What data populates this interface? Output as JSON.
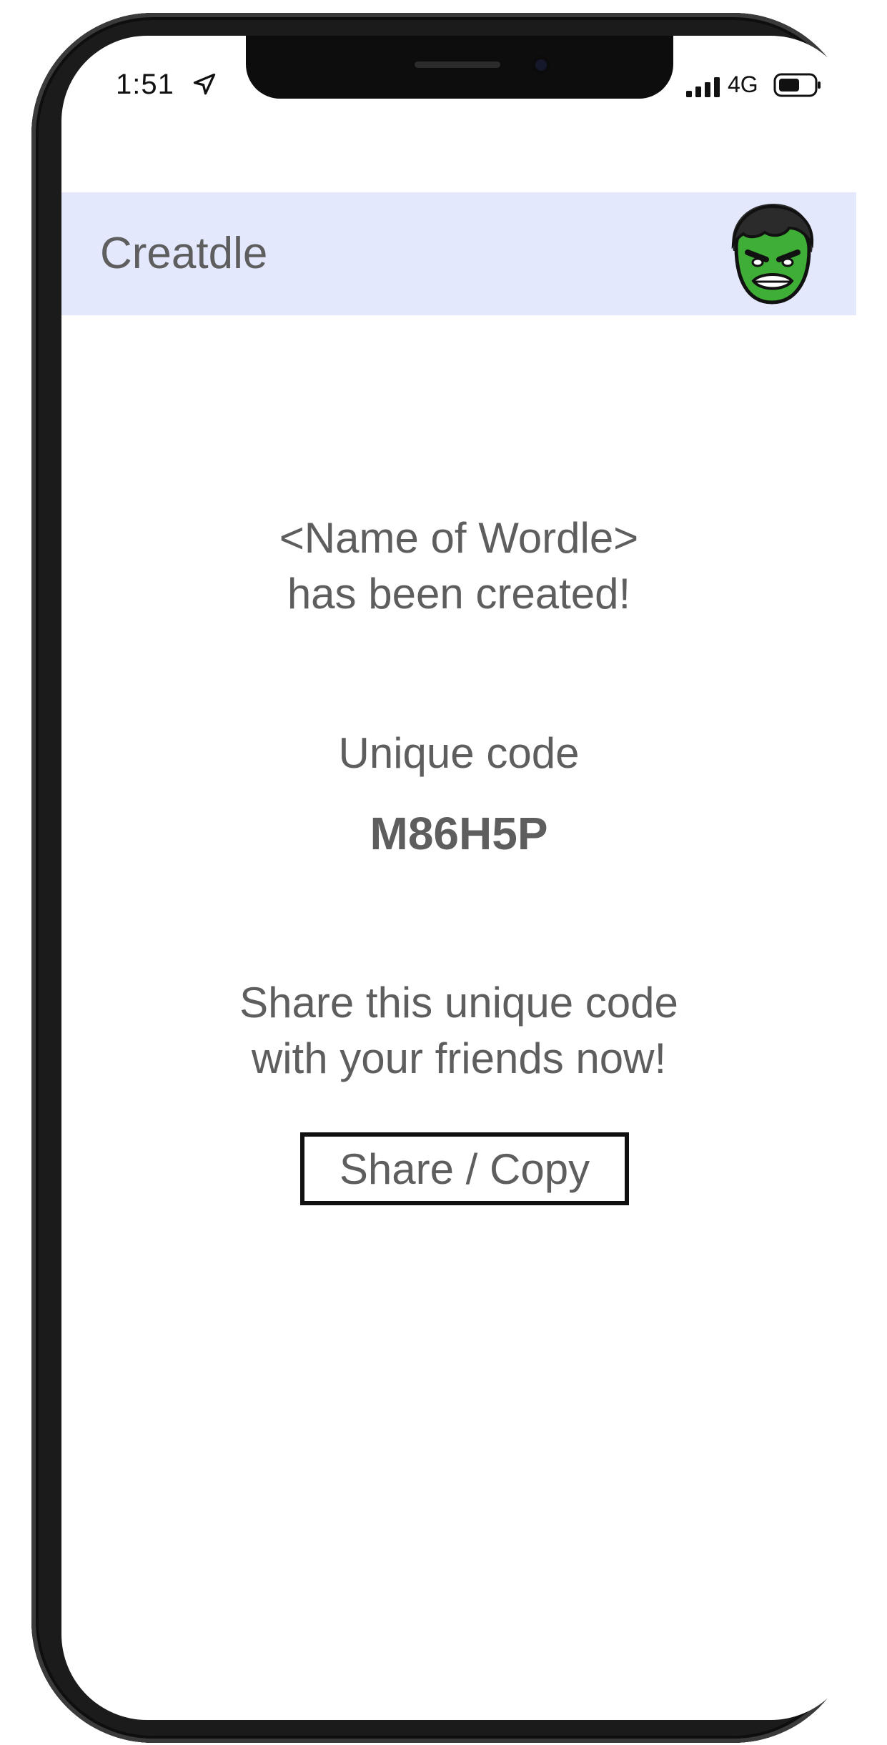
{
  "status_bar": {
    "time": "1:51",
    "network": "4G",
    "icons": [
      "location-arrow-icon",
      "cellular-signal-icon",
      "battery-icon"
    ]
  },
  "header": {
    "title": "Creatdle",
    "avatar_icon": "hulk-avatar-icon",
    "background_color": "#e3e8fd"
  },
  "main": {
    "created_line1": "<Name of Wordle>",
    "created_line2": "has been created!",
    "code_label": "Unique code",
    "code_value": "M86H5P",
    "share_line1": "Share this unique code",
    "share_line2": "with your friends now!",
    "share_button_label": "Share / Copy"
  },
  "colors": {
    "text": "#5e5e5e",
    "button_border": "#111111",
    "avatar_green": "#3fae37"
  }
}
